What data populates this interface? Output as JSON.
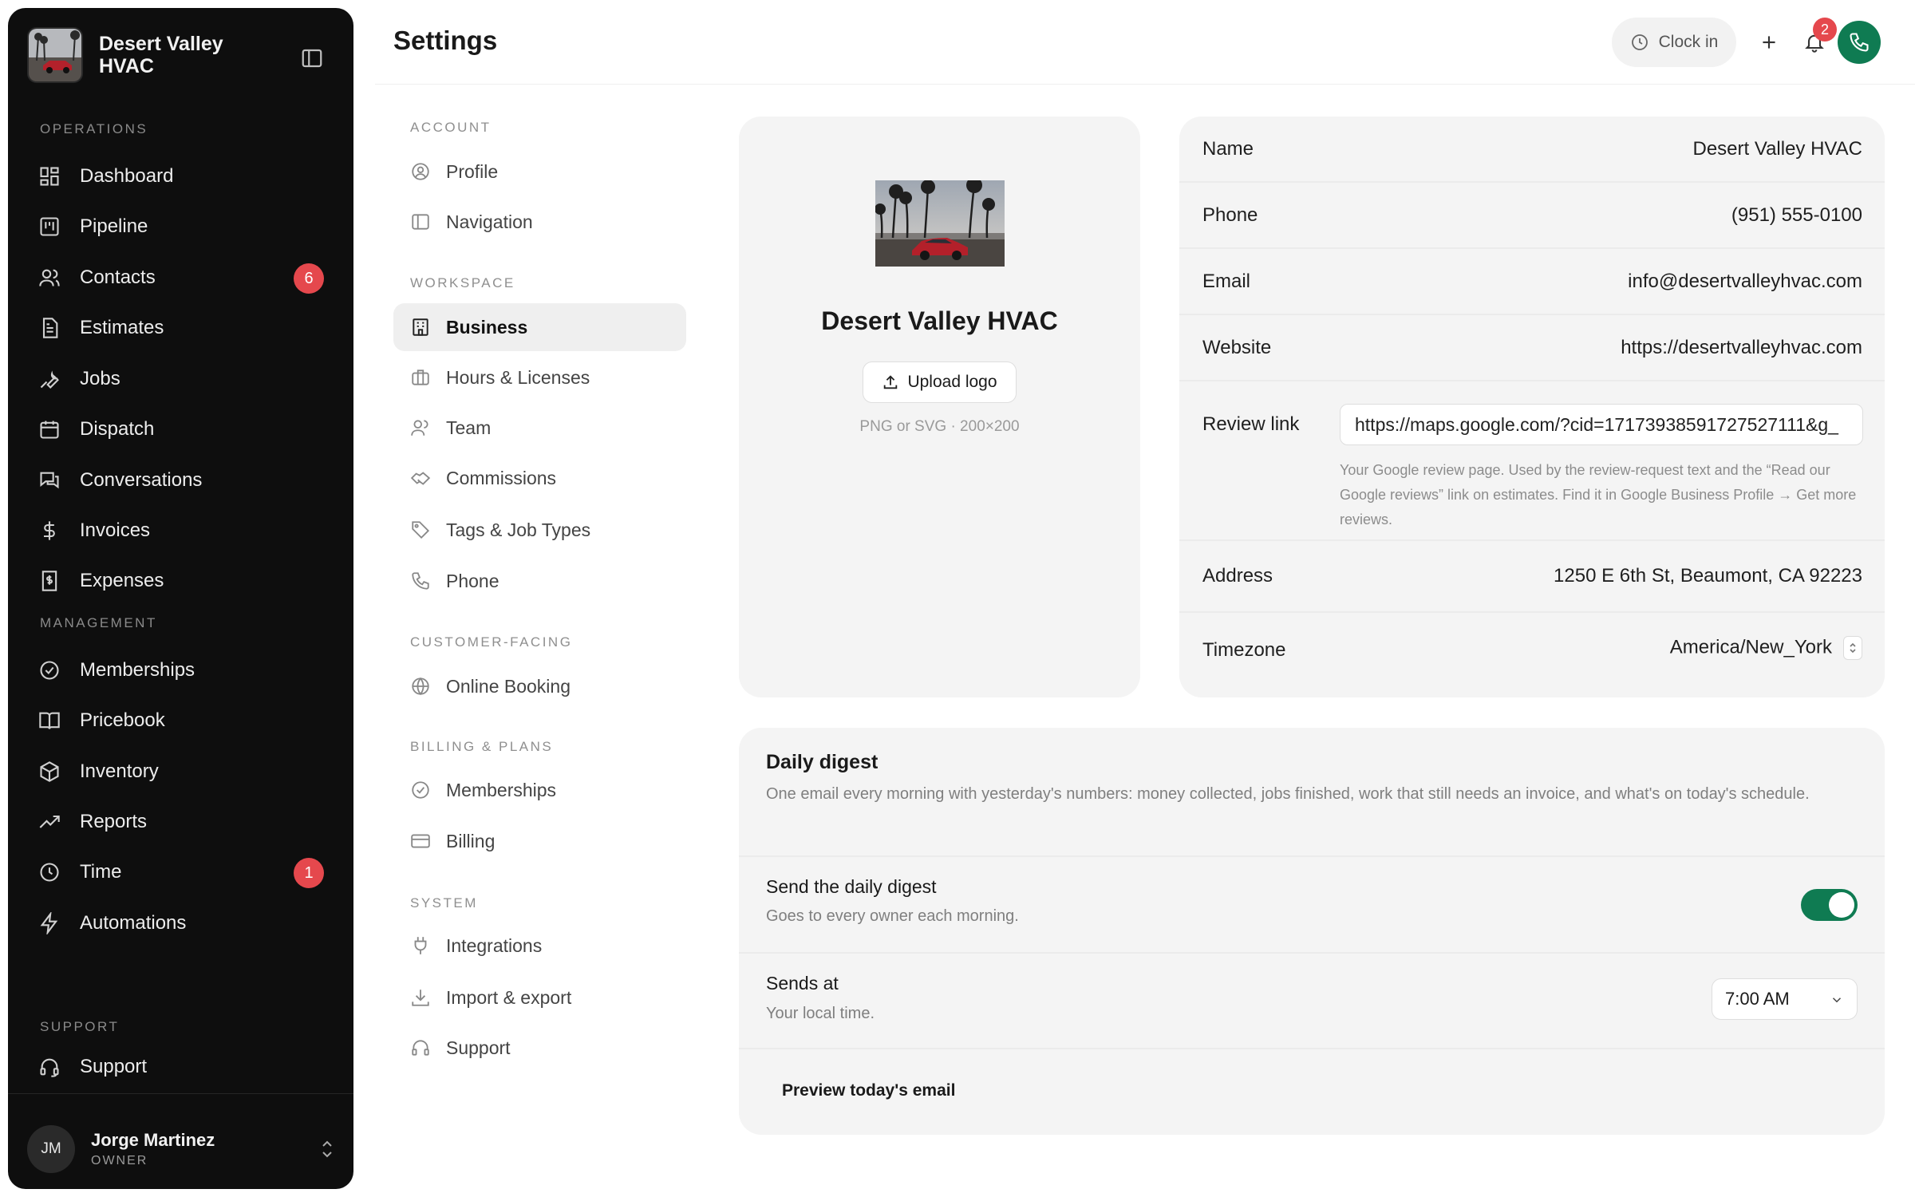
{
  "sidebar": {
    "brand_name": "Desert Valley HVAC",
    "sections": {
      "operations": "OPERATIONS",
      "management": "MANAGEMENT",
      "support": "SUPPORT"
    },
    "items": [
      {
        "label": "Dashboard",
        "icon": "dashboard-icon"
      },
      {
        "label": "Pipeline",
        "icon": "pipeline-icon"
      },
      {
        "label": "Contacts",
        "icon": "contacts-icon",
        "badge": "6"
      },
      {
        "label": "Estimates",
        "icon": "estimates-icon"
      },
      {
        "label": "Jobs",
        "icon": "wrench-icon"
      },
      {
        "label": "Dispatch",
        "icon": "calendar-icon"
      },
      {
        "label": "Conversations",
        "icon": "chat-icon"
      },
      {
        "label": "Invoices",
        "icon": "dollar-icon"
      },
      {
        "label": "Expenses",
        "icon": "receipt-icon"
      },
      {
        "label": "Memberships",
        "icon": "check-badge-icon"
      },
      {
        "label": "Pricebook",
        "icon": "book-icon"
      },
      {
        "label": "Inventory",
        "icon": "box-icon"
      },
      {
        "label": "Reports",
        "icon": "trend-icon"
      },
      {
        "label": "Time",
        "icon": "clock-icon",
        "badge": "1"
      },
      {
        "label": "Automations",
        "icon": "bolt-icon"
      },
      {
        "label": "Support",
        "icon": "headset-icon"
      }
    ],
    "user": {
      "initials": "JM",
      "name": "Jorge Martinez",
      "role": "OWNER"
    }
  },
  "header": {
    "title": "Settings",
    "clock_in_label": "Clock in",
    "notification_count": "2"
  },
  "settings_nav": {
    "sections": {
      "account": "ACCOUNT",
      "workspace": "WORKSPACE",
      "customer_facing": "CUSTOMER-FACING",
      "billing": "BILLING & PLANS",
      "system": "SYSTEM"
    },
    "items": [
      {
        "label": "Profile"
      },
      {
        "label": "Navigation"
      },
      {
        "label": "Business",
        "active": true
      },
      {
        "label": "Hours & Licenses"
      },
      {
        "label": "Team"
      },
      {
        "label": "Commissions"
      },
      {
        "label": "Tags & Job Types"
      },
      {
        "label": "Phone"
      },
      {
        "label": "Online Booking"
      },
      {
        "label": "Memberships"
      },
      {
        "label": "Billing"
      },
      {
        "label": "Integrations"
      },
      {
        "label": "Import & export"
      },
      {
        "label": "Support"
      }
    ]
  },
  "logo_card": {
    "business_name": "Desert Valley HVAC",
    "upload_label": "Upload logo",
    "hint": "PNG or SVG · 200×200"
  },
  "business_info": {
    "name_label": "Name",
    "name_value": "Desert Valley HVAC",
    "phone_label": "Phone",
    "phone_value": "(951) 555-0100",
    "email_label": "Email",
    "email_value": "info@desertvalleyhvac.com",
    "website_label": "Website",
    "website_value": "https://desertvalleyhvac.com",
    "review_label": "Review link",
    "review_value": "https://maps.google.com/?cid=17173938591727527111&g_",
    "review_help": "Your Google review page. Used by the review-request text and the “Read our Google reviews” link on estimates. Find it in Google Business Profile → Get more reviews.",
    "address_label": "Address",
    "address_value": "1250 E 6th St, Beaumont, CA 92223",
    "timezone_label": "Timezone",
    "timezone_value": "America/New_York"
  },
  "digest": {
    "title": "Daily digest",
    "description": "One email every morning with yesterday's numbers: money collected, jobs finished, work that still needs an invoice, and what's on today's schedule.",
    "send_label": "Send the daily digest",
    "send_sub": "Goes to every owner each morning.",
    "send_enabled": true,
    "sends_at_label": "Sends at",
    "sends_at_sub": "Your local time.",
    "sends_at_value": "7:00 AM",
    "preview_label": "Preview today's email"
  },
  "colors": {
    "accent": "#0f7b52",
    "badge": "#e5484d",
    "sidebar_bg": "#0e0e0e"
  }
}
